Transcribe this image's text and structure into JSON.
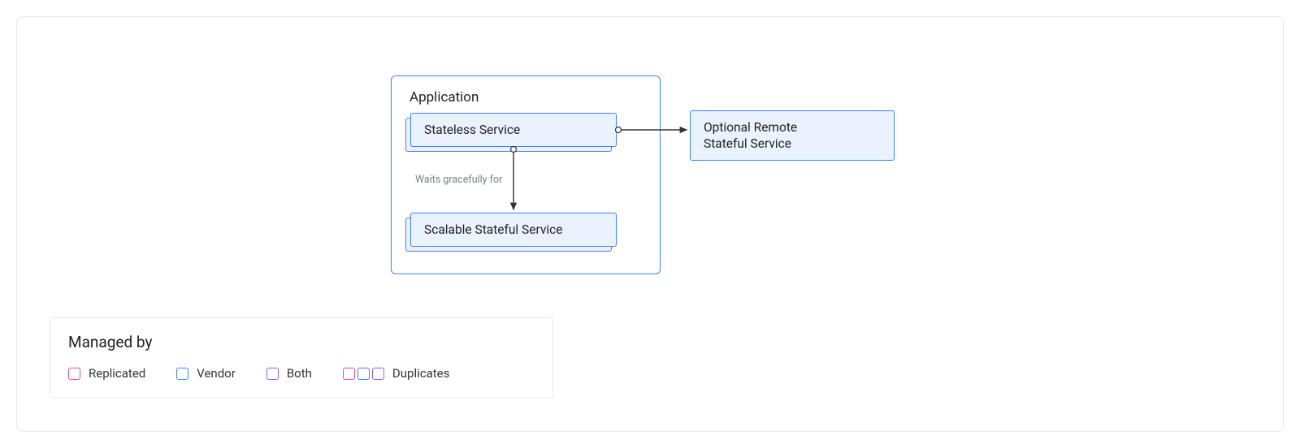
{
  "diagram": {
    "container_label": "Application",
    "nodes": {
      "stateless": "Stateless Service",
      "scalable": "Scalable Stateful Service",
      "remote_line1": "Optional Remote",
      "remote_line2": "Stateful Service"
    },
    "edges": {
      "waits_label": "Waits gracefully for"
    }
  },
  "legend": {
    "title": "Managed by",
    "items": {
      "replicated": "Replicated",
      "vendor": "Vendor",
      "both": "Both",
      "duplicates": "Duplicates"
    }
  },
  "colors": {
    "blue": "#3b82f6",
    "pink": "#ec4899",
    "purple": "#8b5cf6",
    "fill": "#eaf2fe",
    "border_gray": "#e5e7eb",
    "arrow": "#333333"
  }
}
